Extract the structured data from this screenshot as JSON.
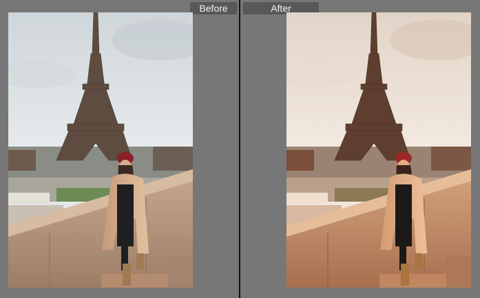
{
  "labels": {
    "before": "Before",
    "after": "After"
  },
  "colors": {
    "background": "#777777",
    "divider": "#101010",
    "label_bg": "#585858",
    "label_text": "#f2f2f2"
  }
}
